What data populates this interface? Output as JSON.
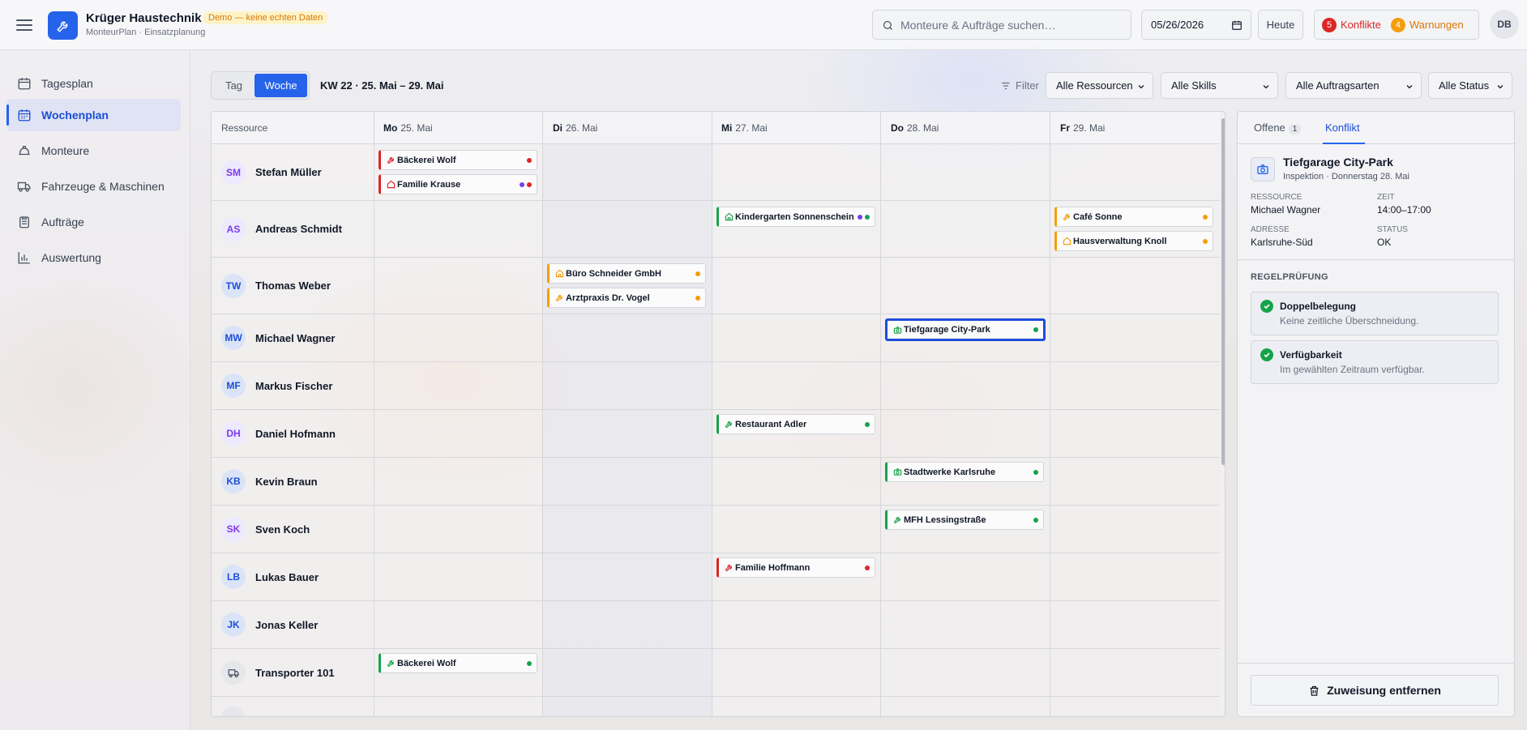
{
  "app": {
    "title": "Krüger Haustechnik",
    "demo_badge": "Demo — keine echten Daten",
    "subtitle": "MonteurPlan · Einsatzplanung"
  },
  "topbar": {
    "search_placeholder": "Monteure & Aufträge suchen…",
    "date_value": "05/26/2026",
    "today_label": "Heute",
    "conflicts_count": "5",
    "conflicts_label": "Konflikte",
    "warnings_count": "4",
    "warnings_label": "Warnungen",
    "user_initials": "DB"
  },
  "sidebar": {
    "items": [
      {
        "label": "Tagesplan",
        "icon": "calendar-day-icon"
      },
      {
        "label": "Wochenplan",
        "icon": "calendar-week-icon"
      },
      {
        "label": "Monteure",
        "icon": "hardhat-icon"
      },
      {
        "label": "Fahrzeuge & Maschinen",
        "icon": "truck-icon"
      },
      {
        "label": "Aufträge",
        "icon": "clipboard-icon"
      },
      {
        "label": "Auswertung",
        "icon": "chart-icon"
      }
    ],
    "active_index": 1
  },
  "toolbar": {
    "view_day": "Tag",
    "view_week": "Woche",
    "week_label": "KW 22 · 25. Mai – 29. Mai",
    "filter_label": "Filter",
    "select_resources": "Alle Ressourcen",
    "select_skills": "Alle Skills",
    "select_types": "Alle Auftragsarten",
    "select_status": "Alle Status"
  },
  "grid": {
    "resource_header": "Ressource",
    "days": [
      {
        "dow": "Mo",
        "date": "25. Mai"
      },
      {
        "dow": "Di",
        "date": "26. Mai"
      },
      {
        "dow": "Mi",
        "date": "27. Mai"
      },
      {
        "dow": "Do",
        "date": "28. Mai"
      },
      {
        "dow": "Fr",
        "date": "29. Mai"
      }
    ],
    "resources": [
      {
        "initials": "SM",
        "name": "Stefan Müller"
      },
      {
        "initials": "AS",
        "name": "Andreas Schmidt"
      },
      {
        "initials": "TW",
        "name": "Thomas Weber"
      },
      {
        "initials": "MW",
        "name": "Michael Wagner"
      },
      {
        "initials": "MF",
        "name": "Markus Fischer"
      },
      {
        "initials": "DH",
        "name": "Daniel Hofmann"
      },
      {
        "initials": "KB",
        "name": "Kevin Braun"
      },
      {
        "initials": "SK",
        "name": "Sven Koch"
      },
      {
        "initials": "LB",
        "name": "Lukas Bauer"
      },
      {
        "initials": "JK",
        "name": "Jonas Keller"
      },
      {
        "initials": "",
        "name": "Transporter 101"
      }
    ],
    "jobs": [
      {
        "label": "Bäckerei Wolf",
        "resource": "Stefan Müller",
        "day": "Mo",
        "status": "red"
      },
      {
        "label": "Familie Krause",
        "resource": "Stefan Müller",
        "day": "Mo",
        "status": "red"
      },
      {
        "label": "Kindergarten Sonnenschein",
        "resource": "Andreas Schmidt",
        "day": "Mi",
        "status": "green"
      },
      {
        "label": "Café Sonne",
        "resource": "Andreas Schmidt",
        "day": "Fr",
        "status": "orange"
      },
      {
        "label": "Hausverwaltung Knoll",
        "resource": "Andreas Schmidt",
        "day": "Fr",
        "status": "orange"
      },
      {
        "label": "Büro Schneider GmbH",
        "resource": "Thomas Weber",
        "day": "Di",
        "status": "orange"
      },
      {
        "label": "Arztpraxis Dr. Vogel",
        "resource": "Thomas Weber",
        "day": "Di",
        "status": "orange"
      },
      {
        "label": "Tiefgarage City-Park",
        "resource": "Michael Wagner",
        "day": "Do",
        "status": "green"
      },
      {
        "label": "Restaurant Adler",
        "resource": "Daniel Hofmann",
        "day": "Mi",
        "status": "green"
      },
      {
        "label": "Stadtwerke Karlsruhe",
        "resource": "Kevin Braun",
        "day": "Do",
        "status": "green"
      },
      {
        "label": "MFH Lessingstraße",
        "resource": "Sven Koch",
        "day": "Do",
        "status": "green"
      },
      {
        "label": "Familie Hoffmann",
        "resource": "Lukas Bauer",
        "day": "Mi",
        "status": "red"
      },
      {
        "label": "Bäckerei Wolf",
        "resource": "Transporter 101",
        "day": "Mo",
        "status": "green"
      }
    ]
  },
  "panel": {
    "tab_open": "Offene",
    "tab_open_count": "1",
    "tab_conflict": "Konflikt",
    "title": "Tiefgarage City-Park",
    "subtitle": "Inspektion · Donnerstag 28. Mai",
    "resource_label": "Ressource",
    "resource_value": "Michael Wagner",
    "time_label": "Zeit",
    "time_value": "14:00–17:00",
    "address_label": "Adresse",
    "address_value": "Karlsruhe-Süd",
    "status_label": "Status",
    "status_value": "OK",
    "rules_title": "REGELPRÜFUNG",
    "rules": [
      {
        "name": "Doppelbelegung",
        "desc": "Keine zeitliche Überschneidung."
      },
      {
        "name": "Verfügbarkeit",
        "desc": "Im gewählten Zeitraum verfügbar."
      }
    ],
    "remove_label": "Zuweisung entfernen"
  },
  "colors": {
    "accent": "#2563eb",
    "red": "#dc2626",
    "green": "#16a34a",
    "orange": "#f59e0b",
    "purple": "#7c3aed"
  }
}
